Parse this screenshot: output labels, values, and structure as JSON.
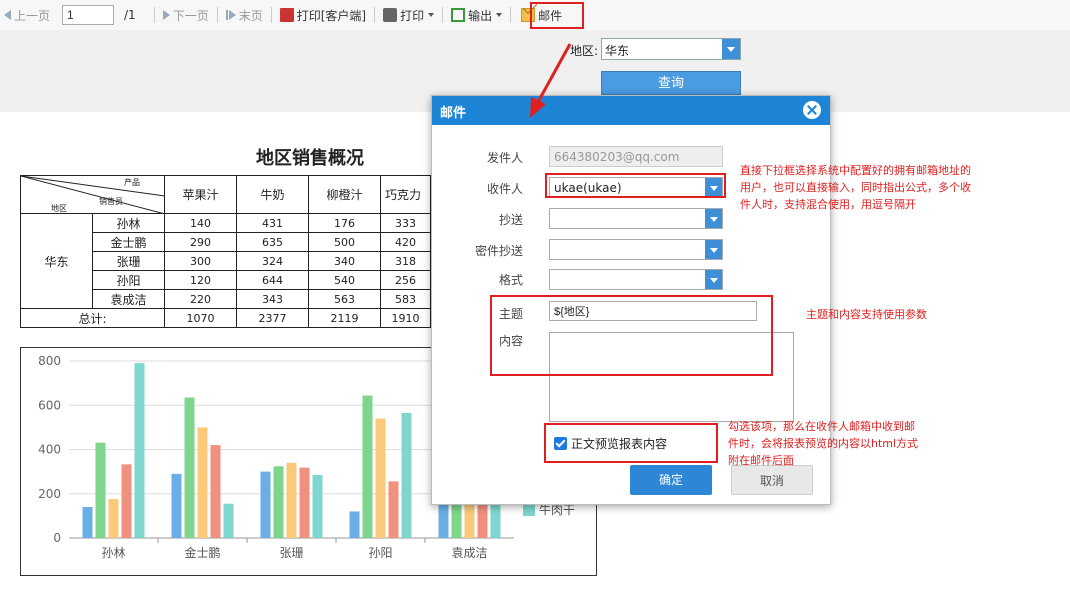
{
  "toolbar": {
    "prev": "上一页",
    "page_value": "1",
    "page_total": "/1",
    "next": "下一页",
    "last": "末页",
    "print_client": "打印[客户端]",
    "print": "打印",
    "export": "输出",
    "mail": "邮件"
  },
  "params": {
    "region_label": "地区:",
    "region_value": "华东",
    "query": "查询"
  },
  "report": {
    "title": "地区销售概况",
    "corner_product": "产品",
    "corner_seller": "销售员",
    "corner_region": "地区",
    "columns": [
      "苹果汁",
      "牛奶",
      "柳橙汁",
      "巧克力"
    ],
    "region": "华东",
    "rows": [
      {
        "name": "孙林",
        "values": [
          "140",
          "431",
          "176",
          "333"
        ]
      },
      {
        "name": "金士鹏",
        "values": [
          "290",
          "635",
          "500",
          "420"
        ]
      },
      {
        "name": "张珊",
        "values": [
          "300",
          "324",
          "340",
          "318"
        ]
      },
      {
        "name": "孙阳",
        "values": [
          "120",
          "644",
          "540",
          "256"
        ]
      },
      {
        "name": "袁成洁",
        "values": [
          "220",
          "343",
          "563",
          "583"
        ]
      }
    ],
    "total_label": "总计:",
    "totals": [
      "1070",
      "2377",
      "2119",
      "1910"
    ]
  },
  "chart_data": {
    "type": "bar",
    "categories": [
      "孙林",
      "金士鹏",
      "张珊",
      "孙阳",
      "袁成洁"
    ],
    "ylim": [
      0,
      800
    ],
    "yticks": [
      "0",
      "200",
      "400",
      "600",
      "800"
    ],
    "series": [
      {
        "values": [
          140,
          290,
          300,
          120,
          220
        ],
        "color": "#6aaee8"
      },
      {
        "values": [
          431,
          635,
          324,
          644,
          343
        ],
        "color": "#7dd68b"
      },
      {
        "values": [
          176,
          500,
          340,
          540,
          563
        ],
        "color": "#fcc97a"
      },
      {
        "values": [
          333,
          420,
          318,
          256,
          583
        ],
        "color": "#f0907e"
      },
      {
        "name": "牛肉干",
        "values": [
          790,
          155,
          285,
          565,
          280
        ],
        "color": "#7ed6cf"
      }
    ]
  },
  "dialog": {
    "title": "邮件",
    "sender_label": "发件人",
    "sender_value": "664380203@qq.com",
    "to_label": "收件人",
    "to_value": "ukae(ukae)",
    "cc_label": "抄送",
    "bcc_label": "密件抄送",
    "format_label": "格式",
    "subject_label": "主题",
    "subject_value": "${地区}",
    "content_label": "内容",
    "preview_label": "正文预览报表内容",
    "ok": "确定",
    "cancel": "取消"
  },
  "notes": {
    "recipient": [
      "直接下拉框选择系统中配置好的拥有邮箱地址的",
      "用户，也可以直接输入，同时指出公式，多个收",
      "件人时，支持混合使用，用逗号隔开"
    ],
    "subject": "主题和内容支持使用参数",
    "preview": [
      "勾选该项，那么在收件人邮箱中收到邮",
      "件时，会将报表预览的内容以html方式",
      "附在邮件后面"
    ]
  },
  "colors": {
    "accent": "#1e85d6",
    "annotation": "#e02020"
  }
}
